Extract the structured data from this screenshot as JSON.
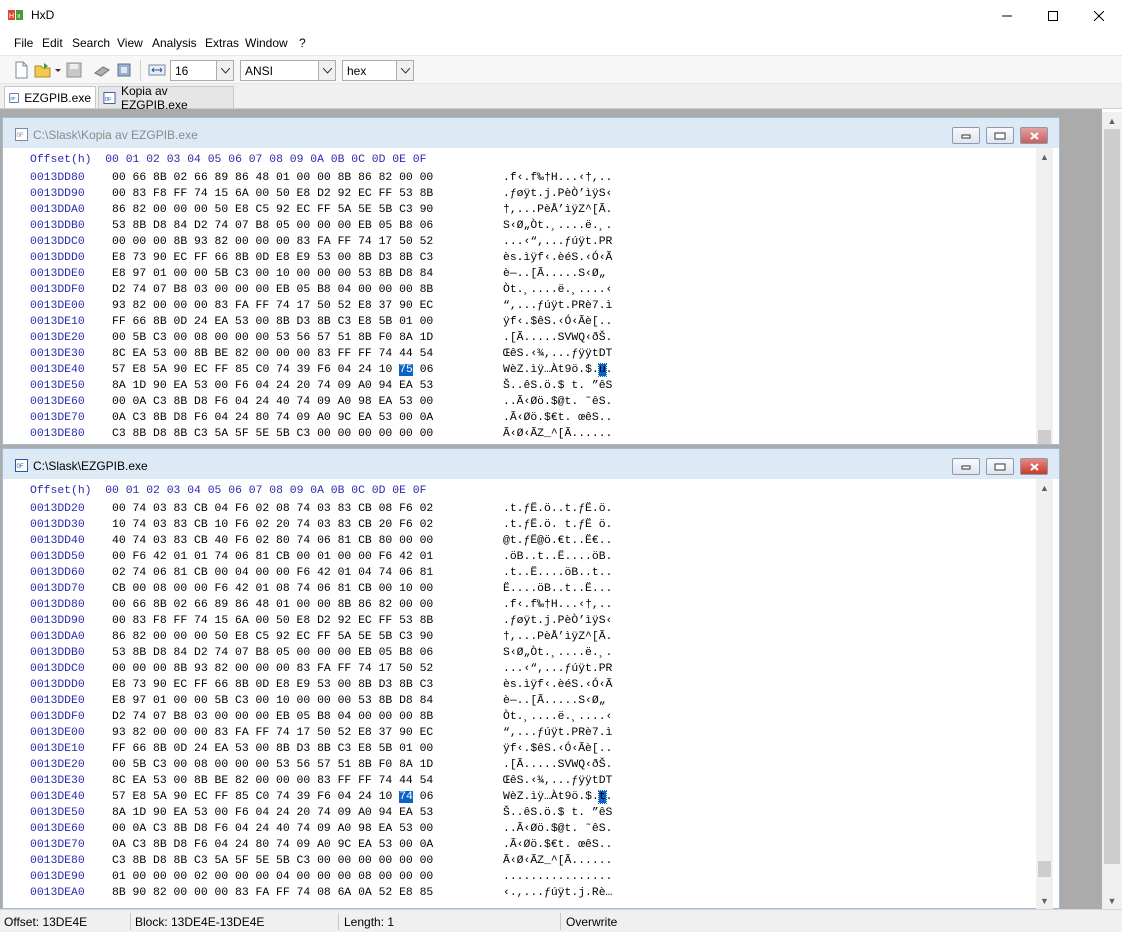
{
  "app": {
    "title": "HxD",
    "colors": {
      "accent": "#0a64c8",
      "caption_active": "#dde9f4",
      "offset_text": "#2a2ab0"
    }
  },
  "menu": [
    "File",
    "Edit",
    "Search",
    "View",
    "Analysis",
    "Extras",
    "Window",
    "?"
  ],
  "toolbar": {
    "bytes_per_row": "16",
    "charset": "ANSI",
    "offset_base": "hex"
  },
  "tabs": [
    {
      "label": "EZGPIB.exe",
      "active": true
    },
    {
      "label": "Kopia av EZGPIB.exe",
      "active": false
    }
  ],
  "editors": [
    {
      "title": "C:\\Slask\\Kopia av EZGPIB.exe",
      "active": false,
      "header": "Offset(h)  00 01 02 03 04 05 06 07 08 09 0A 0B 0C 0D 0E 0F",
      "rows": [
        {
          "off": "0013DD80",
          "hex": "00 66 8B 02 66 89 86 48 01 00 00 8B 86 82 00 00",
          "asc": ".f‹.f‰†H...‹†,.."
        },
        {
          "off": "0013DD90",
          "hex": "00 83 F8 FF 74 15 6A 00 50 E8 D2 92 EC FF 53 8B",
          "asc": ".ƒøÿt.j.PèÒ’ìÿS‹"
        },
        {
          "off": "0013DDA0",
          "hex": "86 82 00 00 00 50 E8 C5 92 EC FF 5A 5E 5B C3 90",
          "asc": "†,...PèÅ’ìÿZ^[Ã."
        },
        {
          "off": "0013DDB0",
          "hex": "53 8B D8 84 D2 74 07 B8 05 00 00 00 EB 05 B8 06",
          "asc": "S‹Ø„Òt.¸....ë.¸."
        },
        {
          "off": "0013DDC0",
          "hex": "00 00 00 8B 93 82 00 00 00 83 FA FF 74 17 50 52",
          "asc": "...‹“,...ƒúÿt.PR"
        },
        {
          "off": "0013DDD0",
          "hex": "E8 73 90 EC FF 66 8B 0D E8 E9 53 00 8B D3 8B C3",
          "asc": "ès.ìÿf‹.èéS.‹Ó‹Ã"
        },
        {
          "off": "0013DDE0",
          "hex": "E8 97 01 00 00 5B C3 00 10 00 00 00 53 8B D8 84",
          "asc": "è—..[Ã.....S‹Ø„"
        },
        {
          "off": "0013DDF0",
          "hex": "D2 74 07 B8 03 00 00 00 EB 05 B8 04 00 00 00 8B",
          "asc": "Òt.¸....ë.¸....‹"
        },
        {
          "off": "0013DE00",
          "hex": "93 82 00 00 00 83 FA FF 74 17 50 52 E8 37 90 EC",
          "asc": "“,...ƒúÿt.PRè7.ì"
        },
        {
          "off": "0013DE10",
          "hex": "FF 66 8B 0D 24 EA 53 00 8B D3 8B C3 E8 5B 01 00",
          "asc": "ÿf‹.$êS.‹Ó‹Ãè[.."
        },
        {
          "off": "0013DE20",
          "hex": "00 5B C3 00 08 00 00 00 53 56 57 51 8B F0 8A 1D",
          "asc": ".[Ã.....SVWQ‹ðŠ."
        },
        {
          "off": "0013DE30",
          "hex": "8C EA 53 00 8B BE 82 00 00 00 83 FF FF 74 44 54",
          "asc": "ŒêS.‹¾,...ƒÿÿtDT"
        },
        {
          "off": "0013DE40",
          "hex": "57 E8 5A 90 EC FF 85 C0 74 39 F6 04 24 10 75 06",
          "asc": "WèZ.ìÿ…Àt9ö.$.u.",
          "sel": 14
        },
        {
          "off": "0013DE50",
          "hex": "8A 1D 90 EA 53 00 F6 04 24 20 74 09 A0 94 EA 53",
          "asc": "Š..êS.ö.$ t. ”êS"
        },
        {
          "off": "0013DE60",
          "hex": "00 0A C3 8B D8 F6 04 24 40 74 09 A0 98 EA 53 00",
          "asc": "..Ã‹Øö.$@t. ˜êS."
        },
        {
          "off": "0013DE70",
          "hex": "0A C3 8B D8 F6 04 24 80 74 09 A0 9C EA 53 00 0A",
          "asc": ".Ã‹Øö.$€t. œêS.."
        },
        {
          "off": "0013DE80",
          "hex": "C3 8B D8 8B C3 5A 5F 5E 5B C3 00 00 00 00 00 00",
          "asc": "Ã‹Ø‹ÃZ_^[Ã......"
        }
      ]
    },
    {
      "title": "C:\\Slask\\EZGPIB.exe",
      "active": true,
      "header": "Offset(h)  00 01 02 03 04 05 06 07 08 09 0A 0B 0C 0D 0E 0F",
      "rows": [
        {
          "off": "0013DD20",
          "hex": "00 74 03 83 CB 04 F6 02 08 74 03 83 CB 08 F6 02",
          "asc": ".t.ƒË.ö..t.ƒË.ö."
        },
        {
          "off": "0013DD30",
          "hex": "10 74 03 83 CB 10 F6 02 20 74 03 83 CB 20 F6 02",
          "asc": ".t.ƒË.ö. t.ƒË ö."
        },
        {
          "off": "0013DD40",
          "hex": "40 74 03 83 CB 40 F6 02 80 74 06 81 CB 80 00 00",
          "asc": "@t.ƒË@ö.€t..Ë€.."
        },
        {
          "off": "0013DD50",
          "hex": "00 F6 42 01 01 74 06 81 CB 00 01 00 00 F6 42 01",
          "asc": ".öB..t..Ë....öB."
        },
        {
          "off": "0013DD60",
          "hex": "02 74 06 81 CB 00 04 00 00 F6 42 01 04 74 06 81",
          "asc": ".t..Ë....öB..t.."
        },
        {
          "off": "0013DD70",
          "hex": "CB 00 08 00 00 F6 42 01 08 74 06 81 CB 00 10 00",
          "asc": "Ë....öB..t..Ë..."
        },
        {
          "off": "0013DD80",
          "hex": "00 66 8B 02 66 89 86 48 01 00 00 8B 86 82 00 00",
          "asc": ".f‹.f‰†H...‹†,.."
        },
        {
          "off": "0013DD90",
          "hex": "00 83 F8 FF 74 15 6A 00 50 E8 D2 92 EC FF 53 8B",
          "asc": ".ƒøÿt.j.PèÒ’ìÿS‹"
        },
        {
          "off": "0013DDA0",
          "hex": "86 82 00 00 00 50 E8 C5 92 EC FF 5A 5E 5B C3 90",
          "asc": "†,...PèÅ’ìÿZ^[Ã."
        },
        {
          "off": "0013DDB0",
          "hex": "53 8B D8 84 D2 74 07 B8 05 00 00 00 EB 05 B8 06",
          "asc": "S‹Ø„Òt.¸....ë.¸."
        },
        {
          "off": "0013DDC0",
          "hex": "00 00 00 8B 93 82 00 00 00 83 FA FF 74 17 50 52",
          "asc": "...‹“,...ƒúÿt.PR"
        },
        {
          "off": "0013DDD0",
          "hex": "E8 73 90 EC FF 66 8B 0D E8 E9 53 00 8B D3 8B C3",
          "asc": "ès.ìÿf‹.èéS.‹Ó‹Ã"
        },
        {
          "off": "0013DDE0",
          "hex": "E8 97 01 00 00 5B C3 00 10 00 00 00 53 8B D8 84",
          "asc": "è—..[Ã.....S‹Ø„"
        },
        {
          "off": "0013DDF0",
          "hex": "D2 74 07 B8 03 00 00 00 EB 05 B8 04 00 00 00 8B",
          "asc": "Òt.¸....ë.¸....‹"
        },
        {
          "off": "0013DE00",
          "hex": "93 82 00 00 00 83 FA FF 74 17 50 52 E8 37 90 EC",
          "asc": "“,...ƒúÿt.PRè7.ì"
        },
        {
          "off": "0013DE10",
          "hex": "FF 66 8B 0D 24 EA 53 00 8B D3 8B C3 E8 5B 01 00",
          "asc": "ÿf‹.$êS.‹Ó‹Ãè[.."
        },
        {
          "off": "0013DE20",
          "hex": "00 5B C3 00 08 00 00 00 53 56 57 51 8B F0 8A 1D",
          "asc": ".[Ã.....SVWQ‹ðŠ."
        },
        {
          "off": "0013DE30",
          "hex": "8C EA 53 00 8B BE 82 00 00 00 83 FF FF 74 44 54",
          "asc": "ŒêS.‹¾,...ƒÿÿtDT"
        },
        {
          "off": "0013DE40",
          "hex": "57 E8 5A 90 EC FF 85 C0 74 39 F6 04 24 10 74 06",
          "asc": "WèZ.ìÿ…Àt9ö.$.t.",
          "sel": 14
        },
        {
          "off": "0013DE50",
          "hex": "8A 1D 90 EA 53 00 F6 04 24 20 74 09 A0 94 EA 53",
          "asc": "Š..êS.ö.$ t. ”êS"
        },
        {
          "off": "0013DE60",
          "hex": "00 0A C3 8B D8 F6 04 24 40 74 09 A0 98 EA 53 00",
          "asc": "..Ã‹Øö.$@t. ˜êS."
        },
        {
          "off": "0013DE70",
          "hex": "0A C3 8B D8 F6 04 24 80 74 09 A0 9C EA 53 00 0A",
          "asc": ".Ã‹Øö.$€t. œêS.."
        },
        {
          "off": "0013DE80",
          "hex": "C3 8B D8 8B C3 5A 5F 5E 5B C3 00 00 00 00 00 00",
          "asc": "Ã‹Ø‹ÃZ_^[Ã......"
        },
        {
          "off": "0013DE90",
          "hex": "01 00 00 00 02 00 00 00 04 00 00 00 08 00 00 00",
          "asc": "................"
        },
        {
          "off": "0013DEA0",
          "hex": "8B 90 82 00 00 00 83 FA FF 74 08 6A 0A 52 E8 85",
          "asc": "‹.,...ƒúÿt.j.Rè…"
        }
      ]
    }
  ],
  "status": {
    "offset": "Offset: 13DE4E",
    "block": "Block: 13DE4E-13DE4E",
    "length": "Length: 1",
    "mode": "Overwrite"
  }
}
